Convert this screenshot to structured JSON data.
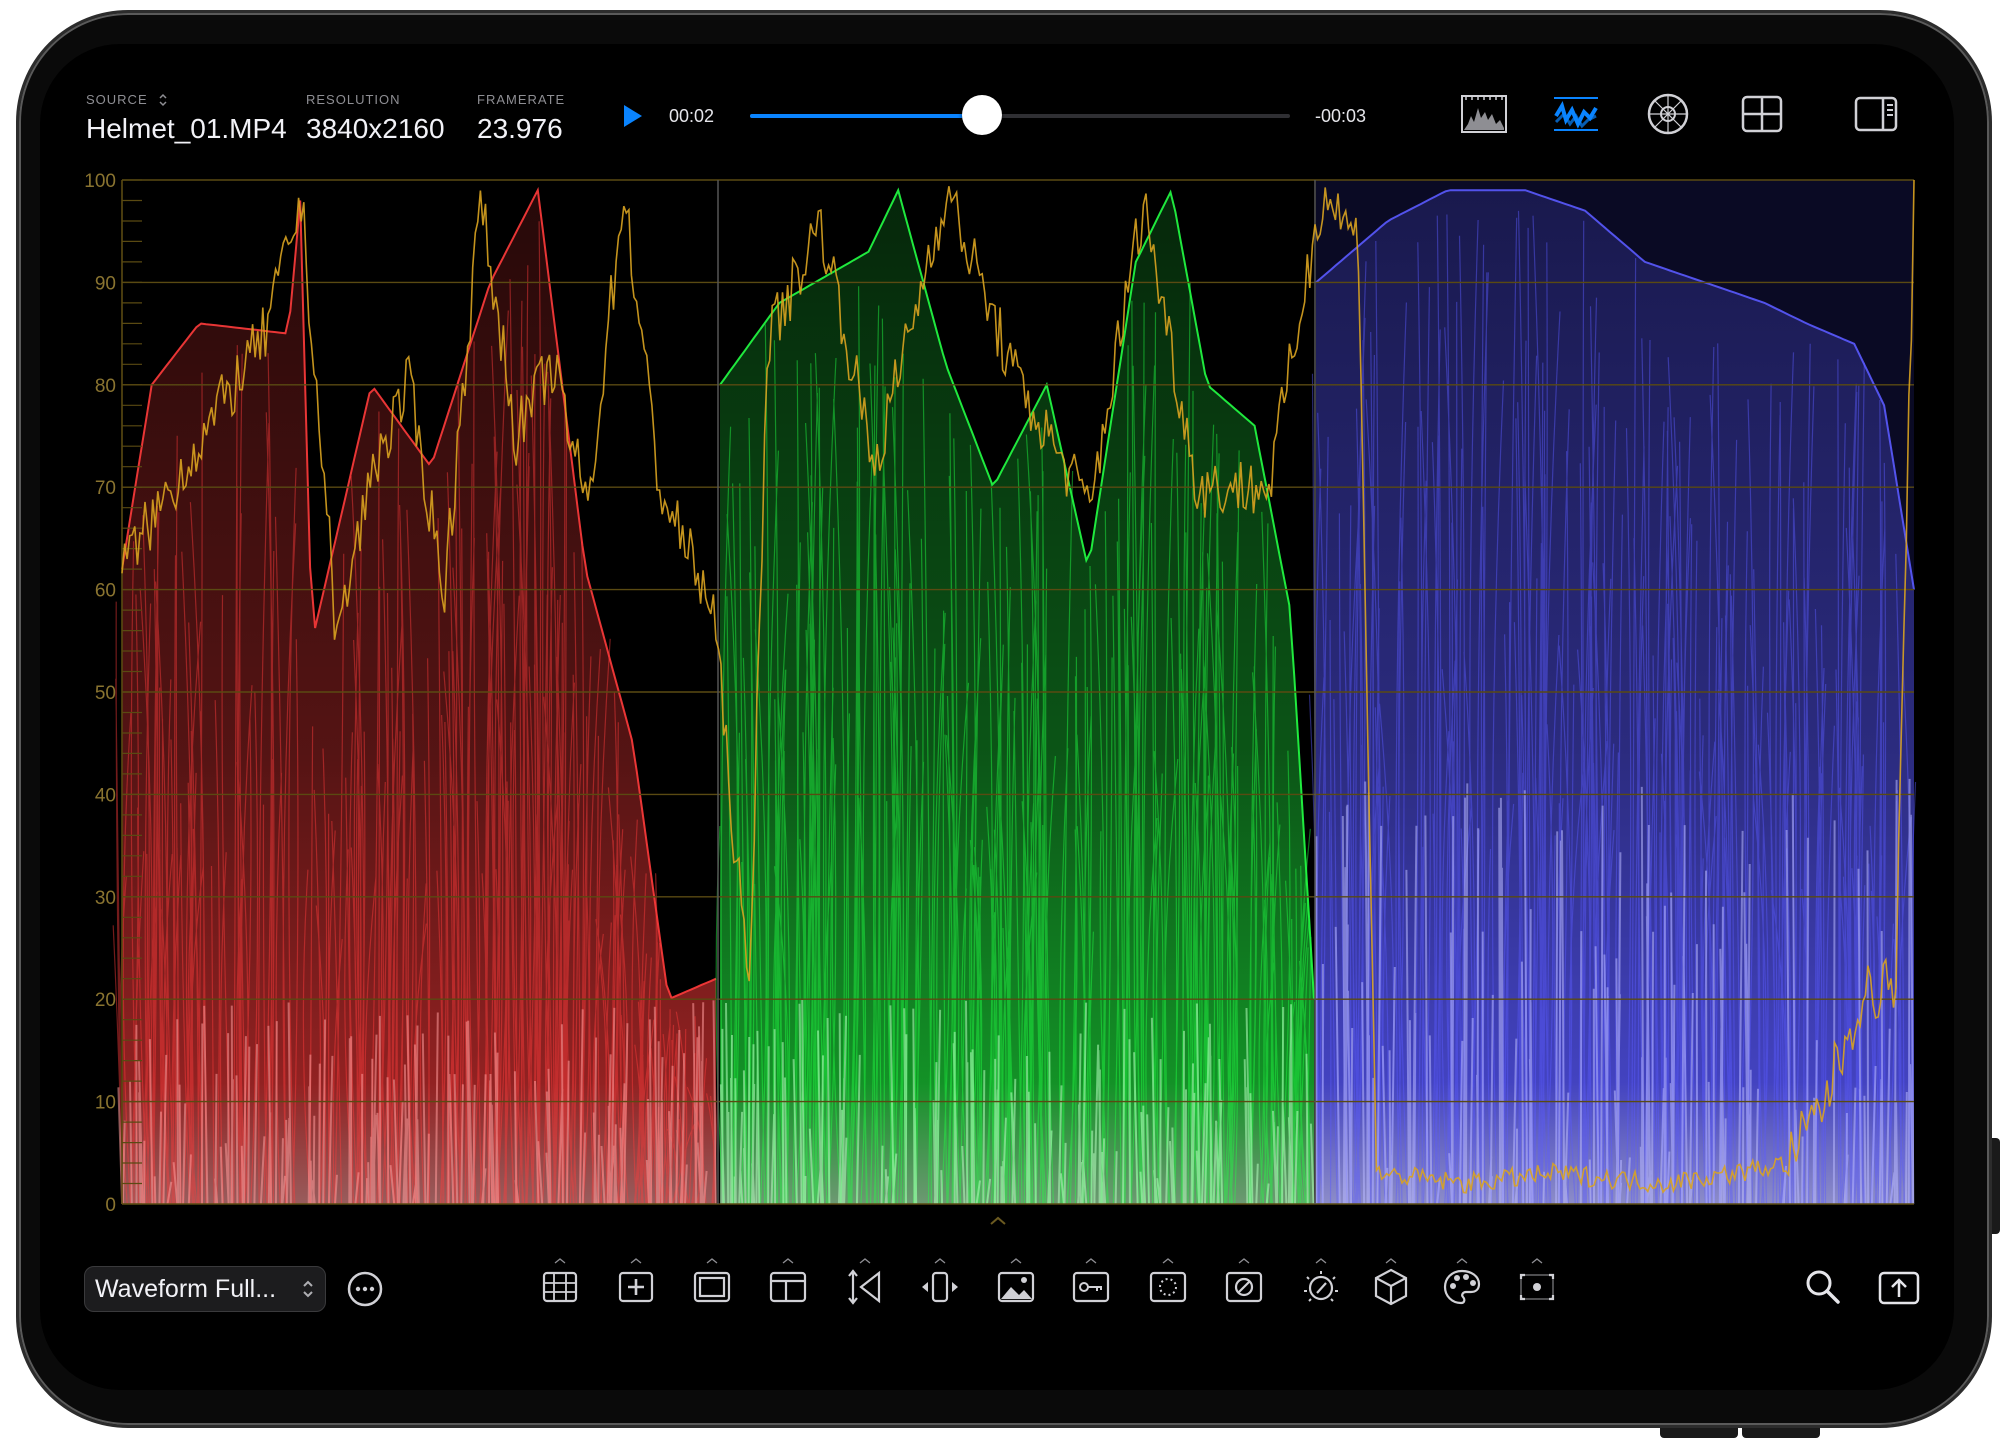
{
  "header": {
    "source": {
      "label": "SOURCE",
      "value": "Helmet_01.MP4"
    },
    "resolution": {
      "label": "RESOLUTION",
      "value": "3840x2160"
    },
    "framerate": {
      "label": "FRAMERATE",
      "value": "23.976"
    }
  },
  "transport": {
    "current_time": "00:02",
    "remaining_time": "-00:03",
    "progress": 0.43,
    "play_icon": "play-icon"
  },
  "view_buttons": [
    {
      "name": "histogram-view-icon",
      "active": false
    },
    {
      "name": "waveform-view-icon",
      "active": true
    },
    {
      "name": "vectorscope-view-icon",
      "active": false
    },
    {
      "name": "quad-layout-icon",
      "active": false
    },
    {
      "name": "side-panel-icon",
      "active": false
    }
  ],
  "scope": {
    "type": "RGB parade waveform",
    "y_ticks": [
      "100",
      "90",
      "80",
      "70",
      "60",
      "50",
      "40",
      "30",
      "20",
      "10",
      "0"
    ],
    "y_range": [
      0,
      100
    ],
    "channels": [
      "red",
      "green",
      "blue"
    ],
    "colors": {
      "red": "#ff3b3b",
      "green": "#22ff44",
      "blue": "#5a5aff",
      "grid": "#5a4a12",
      "trace": "#d9a320",
      "tick_text": "#8a7430"
    }
  },
  "footer": {
    "preset": "Waveform Full...",
    "tools": [
      "grid-icon",
      "crosshair-icon",
      "frame-guide-icon",
      "safe-area-icon",
      "scale-arrows-icon",
      "horizontal-flip-icon",
      "image-overlay-icon",
      "key-icon",
      "dotted-circle-icon",
      "no-entry-icon",
      "exposure-dial-icon",
      "lut-cube-icon",
      "color-palette-icon",
      "focus-point-icon"
    ],
    "right_tools": [
      "search-icon",
      "share-icon"
    ]
  }
}
